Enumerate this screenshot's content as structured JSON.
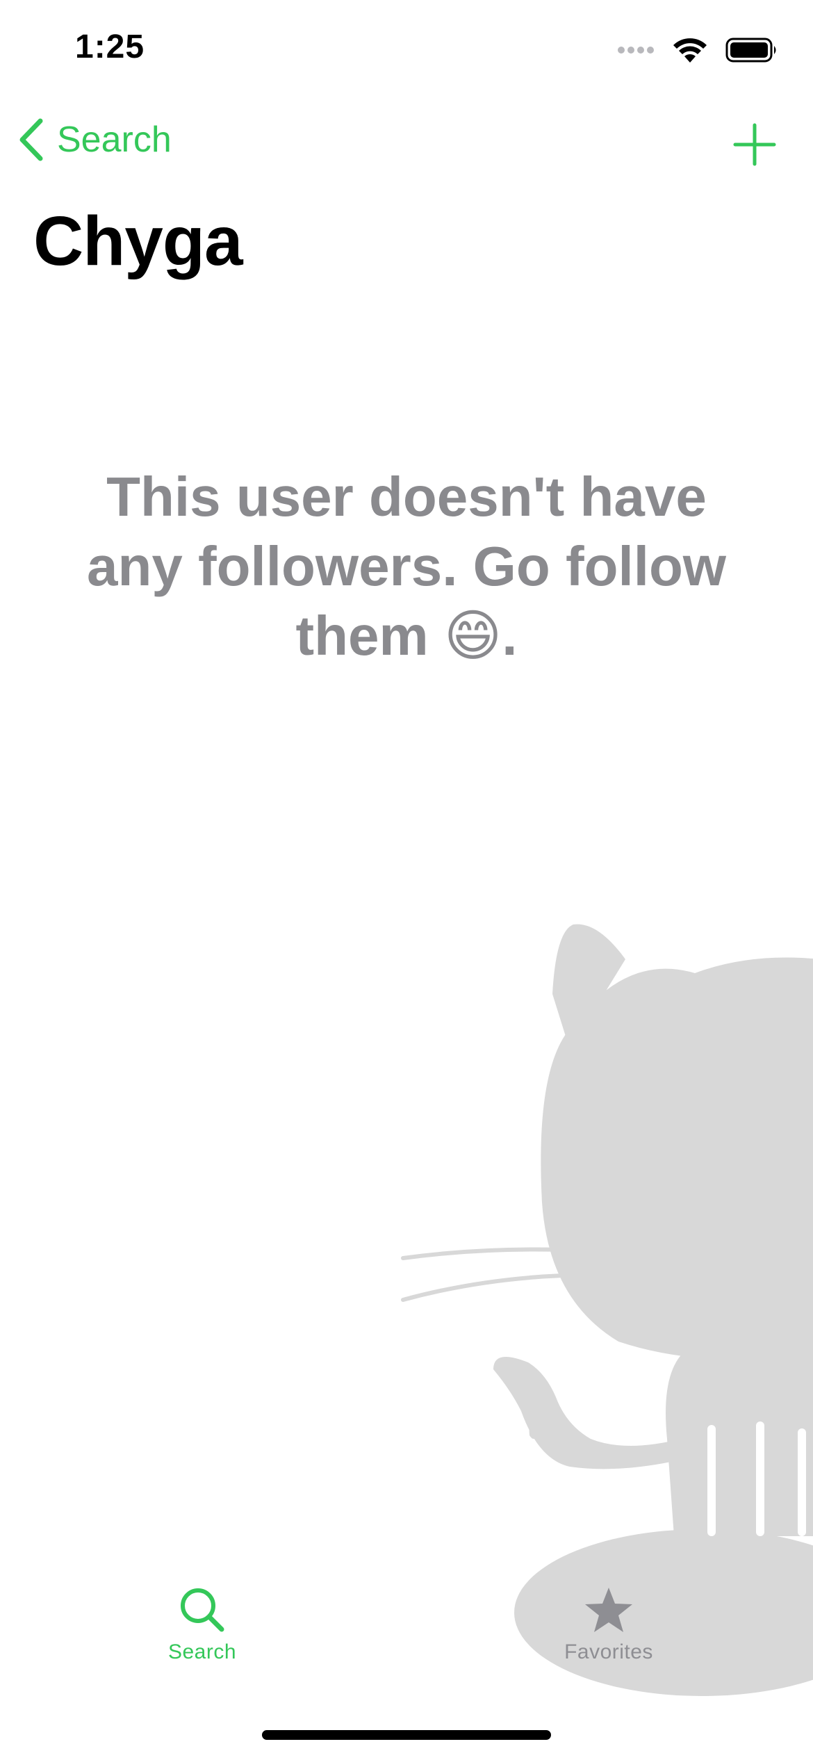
{
  "status_bar": {
    "time": "1:25",
    "icons": [
      "signal-icon",
      "wifi-icon",
      "battery-icon"
    ]
  },
  "nav": {
    "back_label": "Search",
    "back_icon": "chevron-left-icon",
    "add_icon": "plus-icon"
  },
  "page": {
    "title": "Chyga"
  },
  "empty_state": {
    "message": "This user doesn't have any followers. Go follow them 😄.",
    "illustration": "octocat-icon"
  },
  "tabbar": {
    "tabs": [
      {
        "label": "Search",
        "icon": "search-icon",
        "selected": true
      },
      {
        "label": "Favorites",
        "icon": "star-icon",
        "selected": false
      }
    ]
  },
  "colors": {
    "accent": "#34c759",
    "empty_text": "#8a8a8e",
    "tab_inactive": "#8e8e93",
    "illustration": "#d8d8d8"
  }
}
